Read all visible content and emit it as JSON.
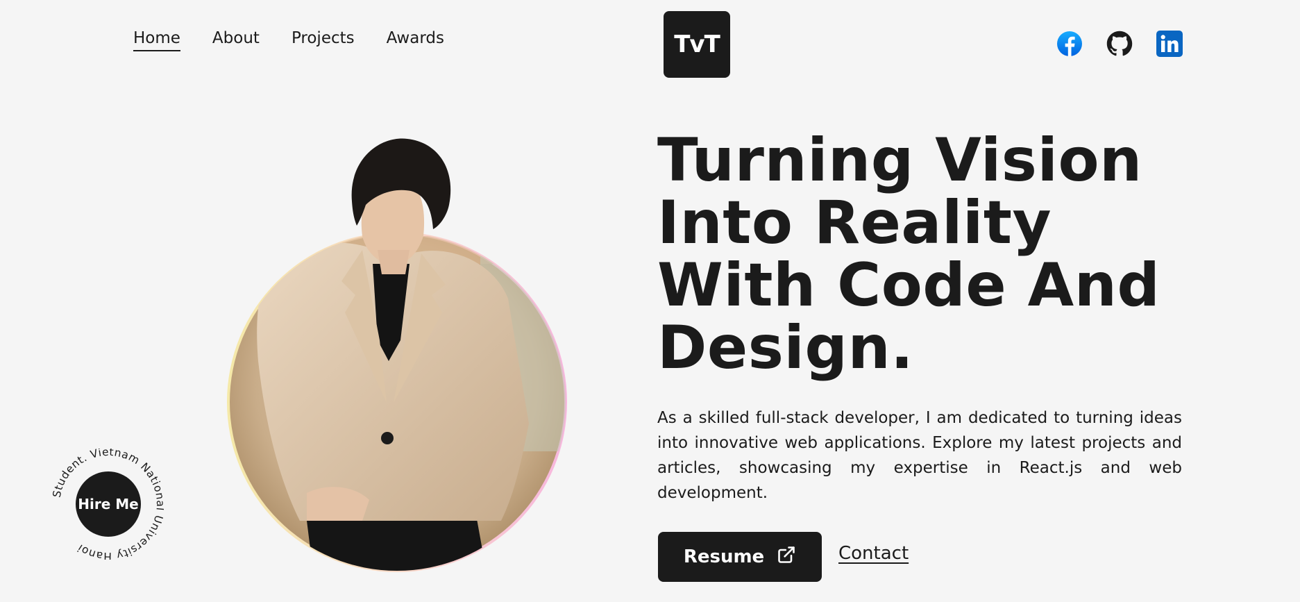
{
  "nav": {
    "items": [
      {
        "label": "Home",
        "active": true
      },
      {
        "label": "About",
        "active": false
      },
      {
        "label": "Projects",
        "active": false
      },
      {
        "label": "Awards",
        "active": false
      }
    ],
    "logo_text": "TvT"
  },
  "socials": [
    {
      "icon": "facebook-icon",
      "color": "#1877f2"
    },
    {
      "icon": "github-icon",
      "color": "#1b1b1b"
    },
    {
      "icon": "linkedin-icon",
      "color": "#0a66c2"
    }
  ],
  "hero": {
    "headline": "Turning Vision Into Reality With Code And Design.",
    "intro": "As a skilled full-stack developer, I am dedicated to turning ideas into innovative web applications. Explore my latest projects and articles, showcasing my expertise in React.js and web development.",
    "resume_label": "Resume",
    "contact_label": "Contact"
  },
  "hire_badge": {
    "label": "Hire Me",
    "ring_text": "Student. Vietnam National University Hanoi"
  },
  "colors": {
    "background": "#f5f5f5",
    "dark": "#1b1b1b",
    "ring_gradient": [
      "#f5e9a8",
      "#f7b6de"
    ]
  }
}
